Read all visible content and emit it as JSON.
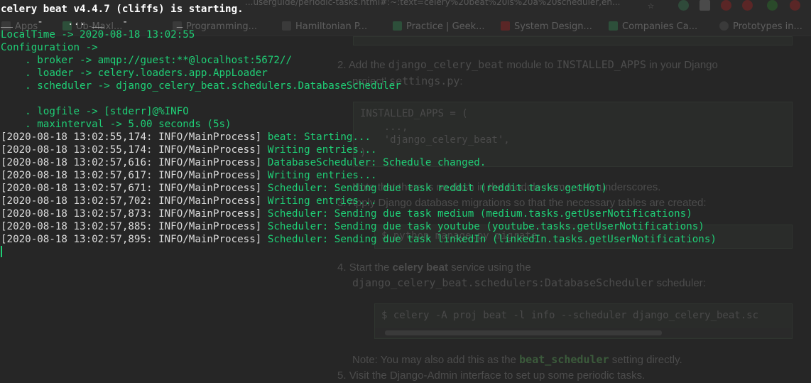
{
  "browser": {
    "url": "...userguide/periodic-tasks.html#:~:text=celery%20beat%20is%20a%20scheduler,en...",
    "bookmarks": [
      {
        "label": "Apps",
        "icon": "apps-grid-icon"
      },
      {
        "label": "Ub-Maxl...",
        "icon": "bookmark-icon"
      },
      {
        "label": "Programming...",
        "icon": "bookmark-icon"
      },
      {
        "label": "Hamiltonian P...",
        "icon": "bookmark-icon"
      },
      {
        "label": "Practice | Geek...",
        "icon": "bookmark-icon"
      },
      {
        "label": "System Design...",
        "icon": "youtube-icon"
      },
      {
        "label": "Companies Ca...",
        "icon": "sheets-icon"
      },
      {
        "label": "Prototypes in...",
        "icon": "globe-icon"
      }
    ]
  },
  "doc": {
    "step2_num": "2.",
    "step2_a": "Add the ",
    "step2_code1": "django_celery_beat",
    "step2_b": " module to ",
    "step2_code2": "INSTALLED_APPS",
    "step2_c": " in your Django",
    "step2_d": "project' ",
    "step2_code3": "settings.py",
    "step2_e": ":",
    "code1_lines": [
      "INSTALLED_APPS = (",
      "    ...,",
      "    'django_celery_beat',",
      ")"
    ],
    "note_underscores": "Note that there is no dash in the module name, only underscores.",
    "step3_num": "3.",
    "step3_text": "Apply Django database migrations so that the necessary tables are created:",
    "code2": "$ python manage.py migrate",
    "step4_num": "4.",
    "step4_a": "Start the ",
    "step4_bold": "celery beat",
    "step4_b": " service using the",
    "step4_code": "django_celery_beat.schedulers:DatabaseScheduler",
    "step4_c": " scheduler:",
    "code3": "$ celery -A proj beat -l info --scheduler django_celery_beat.sc",
    "note_a": "Note: You may also add this as the ",
    "note_code": "beat_scheduler",
    "note_b": " setting directly.",
    "step5_num": "5.",
    "step5_text": "Visit the Django-Admin interface to set up some periodic tasks."
  },
  "terminal": {
    "title": "celery beat v4.4.7 (cliffs) is starting.",
    "rule": "__    -    ... __   -        _",
    "local_time": "LocalTime -> 2020-08-18 13:02:55",
    "configuration": "Configuration ->",
    "broker": "    . broker -> amqp://guest:**@localhost:5672//",
    "loader": "    . loader -> celery.loaders.app.AppLoader",
    "scheduler": "    . scheduler -> django_celery_beat.schedulers.DatabaseScheduler",
    "logfile": "    . logfile -> [stderr]@%INFO",
    "maxinterval": "    . maxinterval -> 5.00 seconds (5s)",
    "logs": [
      {
        "prefix": "[2020-08-18 13:02:55,174: INFO/MainProcess]",
        "message": " beat: Starting..."
      },
      {
        "prefix": "[2020-08-18 13:02:55,174: INFO/MainProcess]",
        "message": " Writing entries..."
      },
      {
        "prefix": "[2020-08-18 13:02:57,616: INFO/MainProcess]",
        "message": " DatabaseScheduler: Schedule changed."
      },
      {
        "prefix": "[2020-08-18 13:02:57,617: INFO/MainProcess]",
        "message": " Writing entries..."
      },
      {
        "prefix": "[2020-08-18 13:02:57,671: INFO/MainProcess]",
        "message": " Scheduler: Sending due task reddit (reddit.tasks.getHot)"
      },
      {
        "prefix": "[2020-08-18 13:02:57,702: INFO/MainProcess]",
        "message": " Writing entries..."
      },
      {
        "prefix": "[2020-08-18 13:02:57,873: INFO/MainProcess]",
        "message": " Scheduler: Sending due task medium (medium.tasks.getUserNotifications)"
      },
      {
        "prefix": "[2020-08-18 13:02:57,885: INFO/MainProcess]",
        "message": " Scheduler: Sending due task youtube (youtube.tasks.getUserNotifications)"
      },
      {
        "prefix": "[2020-08-18 13:02:57,895: INFO/MainProcess]",
        "message": " Scheduler: Sending due task linkedIn (linkedIn.tasks.getUserNotifications)"
      }
    ]
  },
  "colors": {
    "terminal_green": "#1fcf76",
    "terminal_white": "#dcdcdc",
    "background": "#1f1f1f"
  }
}
